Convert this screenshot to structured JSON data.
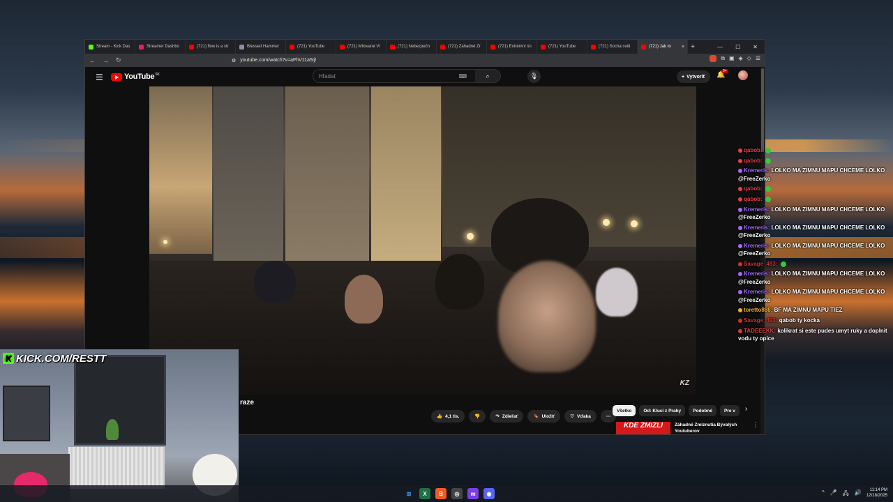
{
  "browser": {
    "tabs": [
      {
        "label": "Stream - Kick Das",
        "color": "#53fc18",
        "active": false
      },
      {
        "label": "Streamer Dashbo",
        "color": "#e91e63",
        "active": false
      },
      {
        "label": "(721) flow is a str",
        "color": "#ff0000",
        "active": false
      },
      {
        "label": "Blessed Hammer",
        "color": "#8a8fa8",
        "active": false
      },
      {
        "label": "(721) YouTube",
        "color": "#ff0000",
        "active": false
      },
      {
        "label": "(721) Milované Vi",
        "color": "#ff0000",
        "active": false
      },
      {
        "label": "(721) Nebezpečn",
        "color": "#ff0000",
        "active": false
      },
      {
        "label": "(721) Záhadné Zr",
        "color": "#ff0000",
        "active": false
      },
      {
        "label": "(721) Extrémní śn",
        "color": "#ff0000",
        "active": false
      },
      {
        "label": "(721) YouTube",
        "color": "#ff0000",
        "active": false
      },
      {
        "label": "(721) Socha svět",
        "color": "#ff0000",
        "active": false
      },
      {
        "label": "(721) Jak to",
        "color": "#ff0000",
        "active": true
      }
    ],
    "new_tab": "+",
    "close_tab": "×",
    "win_controls": {
      "minimize": "—",
      "maximize": "☐",
      "close": "✕"
    },
    "url": "youtube.com/watch?v=aFhV11a5Ij!",
    "back": "←",
    "forward": "→",
    "reload": "↻"
  },
  "youtube": {
    "logo_text": "YouTube",
    "region": "SK",
    "search_placeholder": "Hľadať",
    "create_label": "Vytvoriť",
    "notif_count": "9+",
    "video_title": "raze",
    "watermark": "KZ",
    "like_count": "4,1 tis.",
    "share_label": "Zdieľať",
    "save_label": "Uložiť",
    "thanks_label": "Vďaka",
    "more": "⋯",
    "chips": [
      "Všetko",
      "Od: Kluci z Prahy",
      "Podobné",
      "Pre v"
    ],
    "chip_next": "›",
    "rec": {
      "thumb_text": "KDE ZMIZLI",
      "title": "Záhadné Zmiznutia Bývalých Youtuberov"
    }
  },
  "chat": [
    {
      "user": "qabob:",
      "color": "#e8404a",
      "text": "",
      "emote": true
    },
    {
      "user": "qabob:",
      "color": "#e8404a",
      "text": "",
      "emote": true
    },
    {
      "user": "Kremeris:",
      "color": "#a569ff",
      "text": "LOLKO MA ZIMNU MAPU CHCEME LOLKO @FreeZerko",
      "emote": false
    },
    {
      "user": "qabob:",
      "color": "#e8404a",
      "text": "",
      "emote": true
    },
    {
      "user": "qabob:",
      "color": "#e8404a",
      "text": "",
      "emote": true
    },
    {
      "user": "Kremeris:",
      "color": "#a569ff",
      "text": "LOLKO MA ZIMNU MAPU CHCEME LOLKO @FreeZerko",
      "emote": false
    },
    {
      "user": "Kremeris:",
      "color": "#a569ff",
      "text": "LOLKO MA ZIMNU MAPU CHCEME LOLKO @FreeZerko",
      "emote": false
    },
    {
      "user": "Kremeris:",
      "color": "#a569ff",
      "text": "LOLKO MA ZIMNU MAPU CHCEME LOLKO @FreeZerko",
      "emote": false
    },
    {
      "user": "Savage_493:",
      "color": "#d03030",
      "text": "",
      "emote": true
    },
    {
      "user": "Kremeris:",
      "color": "#a569ff",
      "text": "LOLKO MA ZIMNU MAPU CHCEME LOLKO @FreeZerko",
      "emote": false
    },
    {
      "user": "Kremeris:",
      "color": "#a569ff",
      "text": "LOLKO MA ZIMNU MAPU CHCEME LOLKO @FreeZerko",
      "emote": false
    },
    {
      "user": "toretto888:",
      "color": "#f0b030",
      "text": "BF MA ZIMNU MAPU TIEZ",
      "emote": false
    },
    {
      "user": "Savage_493:",
      "color": "#d03030",
      "text": "qabob ty kocka",
      "emote": false
    },
    {
      "user": "TADEEEKK:",
      "color": "#e03a3a",
      "text": "kolikrat si este pudes umyt ruky a doplnit vodu ty opice",
      "emote": false
    }
  ],
  "overlay": {
    "kick_label": "KICK.COM/RESTT",
    "kick_letter": "K"
  },
  "taskbar": {
    "icons": [
      {
        "name": "windows-start-icon",
        "glyph": "⊞",
        "color": "#3aa0ff",
        "bg": "transparent"
      },
      {
        "name": "excel-icon",
        "glyph": "X",
        "color": "#fff",
        "bg": "#1d7044"
      },
      {
        "name": "brave-icon",
        "glyph": "B",
        "color": "#fff",
        "bg": "#f15a24"
      },
      {
        "name": "chrome-icon",
        "glyph": "◎",
        "color": "#fff",
        "bg": "#444"
      },
      {
        "name": "app-m-icon",
        "glyph": "m",
        "color": "#fff",
        "bg": "#7b3fe4"
      },
      {
        "name": "discord-icon",
        "glyph": "◉",
        "color": "#fff",
        "bg": "#5865f2"
      }
    ],
    "tray": [
      "^",
      "🎤",
      "🖧",
      "🔊"
    ],
    "time": "11:14 PM",
    "date": "12/18/2025"
  }
}
